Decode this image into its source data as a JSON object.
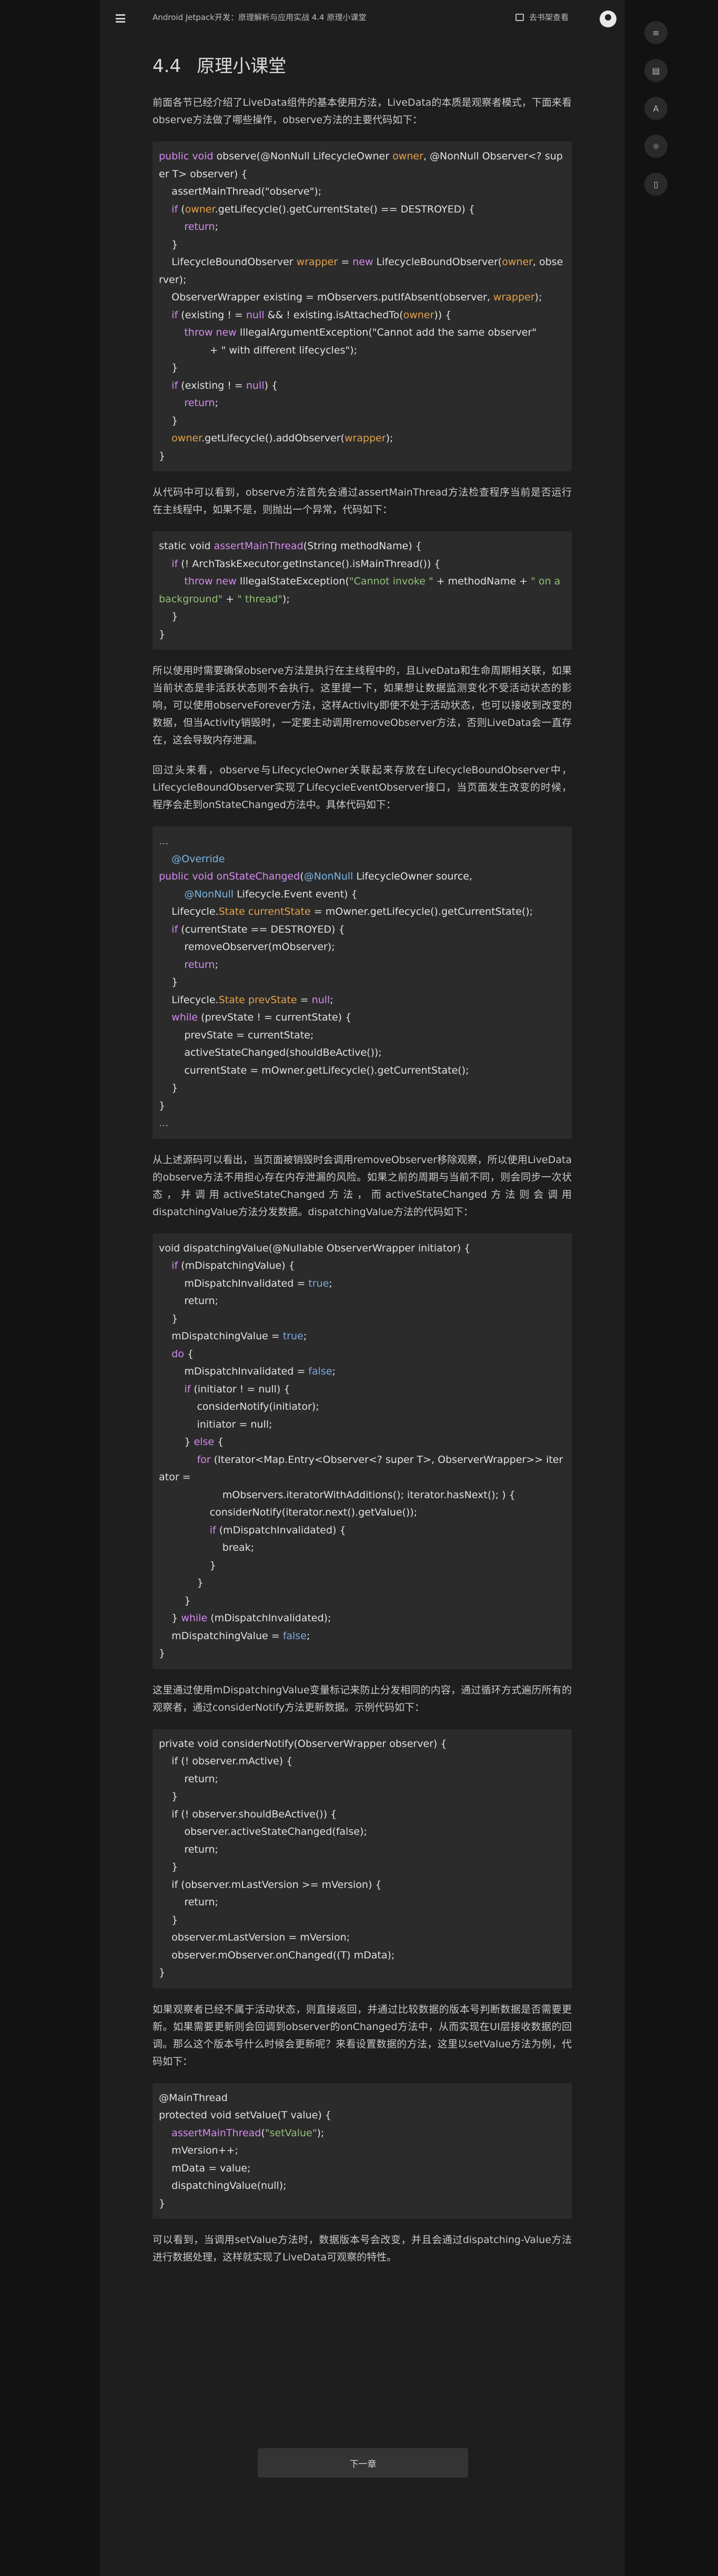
{
  "header": {
    "title": "Android Jetpack开发：原理解析与应用实战 4.4 原理小课堂",
    "bookshelf_label": "去书架查看"
  },
  "section": {
    "number": "4.4",
    "title": "原理小课堂"
  },
  "paragraphs": {
    "p1": "前面各节已经介绍了LiveData组件的基本使用方法，LiveData的本质是观察者模式，下面来看observe方法做了哪些操作，observe方法的主要代码如下：",
    "p2": "从代码中可以看到，observe方法首先会通过assertMainThread方法检查程序当前是否运行在主线程中，如果不是，则抛出一个异常，代码如下：",
    "p3": "所以使用时需要确保observe方法是执行在主线程中的，且LiveData和生命周期相关联，如果当前状态是非活跃状态则不会执行。这里提一下，如果想让数据监测变化不受活动状态的影响，可以使用observeForever方法，这样Activity即使不处于活动状态，也可以接收到改变的数据，但当Activity销毁时，一定要主动调用removeObserver方法，否则LiveData会一直存在，这会导致内存泄漏。",
    "p4": "回过头来看，observe与LifecycleOwner关联起来存放在LifecycleBoundObserver中，LifecycleBoundObserver实现了LifecycleEventObserver接口，当页面发生改变的时候，程序会走到onStateChanged方法中。具体代码如下：",
    "p5": "从上述源码可以看出，当页面被销毁时会调用removeObserver移除观察，所以使用LiveData的observe方法不用担心存在内存泄漏的风险。如果之前的周期与当前不同，则会同步一次状态，并调用activeStateChanged方法，而activeStateChanged方法则会调用dispatchingValue方法分发数据。dispatchingValue方法的代码如下：",
    "p6": "这里通过使用mDispatchingValue变量标记来防止分发相同的内容，通过循环方式遍历所有的观察者，通过considerNotify方法更新数据。示例代码如下：",
    "p7": "如果观察者已经不属于活动状态，则直接返回，并通过比较数据的版本号判断数据是否需要更新。如果需要更新则会回调到observer的onChanged方法中，从而实现在UI层接收数据的回调。那么这个版本号什么时候会更新呢？来看设置数据的方法，这里以setValue方法为例，代码如下：",
    "p8": "可以看到，当调用setValue方法时，数据版本号会改变，并且会通过dispatching-Value方法进行数据处理，这样就实现了LiveData可观察的特性。"
  },
  "code_blocks": {
    "observe": "public void observe(@NonNull LifecycleOwner owner, @NonNull Observer<? super T> observer) {\n    assertMainThread(\"observe\");\n    if (owner.getLifecycle().getCurrentState() == DESTROYED) {\n        return;\n    }\n    LifecycleBoundObserver wrapper = new LifecycleBoundObserver(owner, observer);\n    ObserverWrapper existing = mObservers.putIfAbsent(observer, wrapper);\n    if (existing ! = null && ! existing.isAttachedTo(owner)) {\n        throw new IllegalArgumentException(\"Cannot add the same observer\"\n                + \" with different lifecycles\");\n    }\n    if (existing ! = null) {\n        return;\n    }\n    owner.getLifecycle().addObserver(wrapper);\n}",
    "assertMainThread": "static void assertMainThread(String methodName) {\n    if (! ArchTaskExecutor.getInstance().isMainThread()) {\n        throw new IllegalStateException(\"Cannot invoke \" + methodName + \" on a background\" + \" thread\");\n    }\n}",
    "onStateChanged": "...\n    @Override\npublic void onStateChanged(@NonNull LifecycleOwner source,\n        @NonNull Lifecycle.Event event) {\n    Lifecycle.State currentState = mOwner.getLifecycle().getCurrentState();\n    if (currentState == DESTROYED) {\n        removeObserver(mObserver);\n        return;\n    }\n    Lifecycle.State prevState = null;\n    while (prevState ! = currentState) {\n        prevState = currentState;\n        activeStateChanged(shouldBeActive());\n        currentState = mOwner.getLifecycle().getCurrentState();\n    }\n}\n...",
    "dispatchingValue": "void dispatchingValue(@Nullable ObserverWrapper initiator) {\n    if (mDispatchingValue) {\n        mDispatchInvalidated = true;\n        return;\n    }\n    mDispatchingValue = true;\n    do {\n        mDispatchInvalidated = false;\n        if (initiator ! = null) {\n            considerNotify(initiator);\n            initiator = null;\n        } else {\n            for (Iterator<Map.Entry<Observer<? super T>, ObserverWrapper>> iterator =\n                    mObservers.iteratorWithAdditions(); iterator.hasNext(); ) {\n                considerNotify(iterator.next().getValue());\n                if (mDispatchInvalidated) {\n                    break;\n                }\n            }\n        }\n    } while (mDispatchInvalidated);\n    mDispatchingValue = false;\n}",
    "considerNotify": "private void considerNotify(ObserverWrapper observer) {\n    if (! observer.mActive) {\n        return;\n    }\n    if (! observer.shouldBeActive()) {\n        observer.activeStateChanged(false);\n        return;\n    }\n    if (observer.mLastVersion >= mVersion) {\n        return;\n    }\n    observer.mLastVersion = mVersion;\n    observer.mObserver.onChanged((T) mData);\n}",
    "setValue": "@MainThread\nprotected void setValue(T value) {\n    assertMainThread(\"setValue\");\n    mVersion++;\n    mData = value;\n    dispatchingValue(null);\n}"
  },
  "footer": {
    "next_label": "下一章"
  },
  "rail_icons": [
    "list-icon",
    "comment-icon",
    "font-icon",
    "theme-icon",
    "phone-icon"
  ],
  "colors": {
    "page_bg": "#121212",
    "content_bg": "#1e1e1e",
    "code_bg": "#2b2b2b",
    "keyword": "#d68bf1",
    "variable": "#e6a34a",
    "string": "#93c07a",
    "annotation": "#79b6e6"
  }
}
